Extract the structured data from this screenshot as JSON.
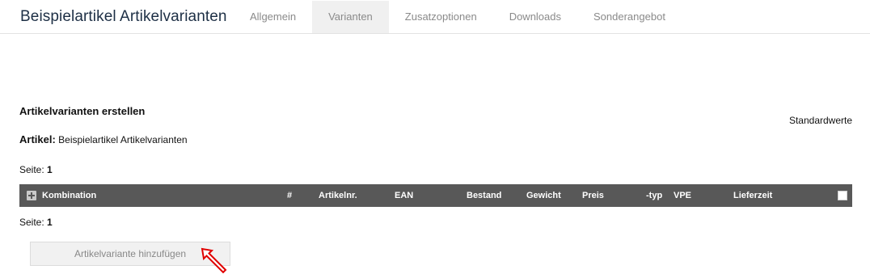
{
  "header": {
    "title": "Beispielartikel Artikelvarianten",
    "tabs": [
      {
        "label": "Allgemein",
        "active": false
      },
      {
        "label": "Varianten",
        "active": true
      },
      {
        "label": "Zusatzoptionen",
        "active": false
      },
      {
        "label": "Downloads",
        "active": false
      },
      {
        "label": "Sonderangebot",
        "active": false
      }
    ]
  },
  "main": {
    "section_title": "Artikelvarianten erstellen",
    "defaults_link": "Standardwerte",
    "article_label": "Artikel:",
    "article_name": "Beispielartikel Artikelvarianten",
    "page_label": "Seite:",
    "page_number": "1",
    "table_columns": [
      "Kombination",
      "#",
      "Artikelnr.",
      "EAN",
      "Bestand",
      "Gewicht",
      "Preis",
      "-typ",
      "VPE",
      "Lieferzeit"
    ],
    "add_button_label": "Artikelvariante hinzufügen"
  },
  "colors": {
    "table_header_bg": "#585858",
    "active_tab_bg": "#f0f0f0",
    "title_color": "#1d2f45",
    "annotation_arrow": "#e00000"
  },
  "icons": {
    "expand": "plus-square-icon",
    "select_all": "checkbox-icon",
    "annotation": "arrow-annotation-icon"
  }
}
